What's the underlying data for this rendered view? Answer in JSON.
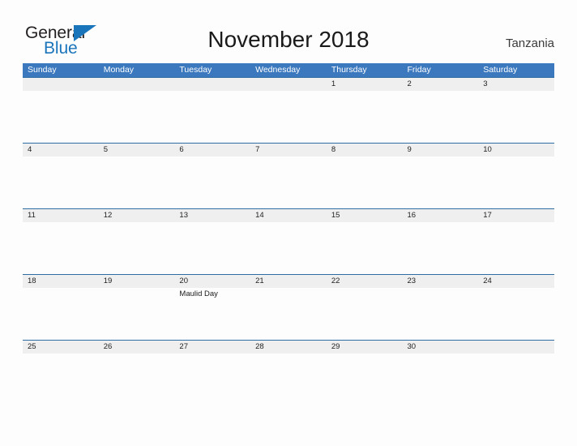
{
  "brand": {
    "name_part1": "General",
    "name_part2": "Blue",
    "triangle_icon": "triangle-icon",
    "color_dark": "#231f20",
    "color_blue": "#1b75bb"
  },
  "header": {
    "title": "November 2018",
    "country": "Tanzania"
  },
  "theme": {
    "header_blue": "#3b78be",
    "rule_blue": "#2e6da4",
    "band_gray": "#efefef",
    "page_background": "#fdfdfd",
    "text_dark": "#222222"
  },
  "calendar": {
    "month": "November",
    "year": "2018",
    "weekday_headers": [
      "Sunday",
      "Monday",
      "Tuesday",
      "Wednesday",
      "Thursday",
      "Friday",
      "Saturday"
    ],
    "weeks": [
      {
        "days": [
          {
            "date": "",
            "events": []
          },
          {
            "date": "",
            "events": []
          },
          {
            "date": "",
            "events": []
          },
          {
            "date": "",
            "events": []
          },
          {
            "date": "1",
            "events": []
          },
          {
            "date": "2",
            "events": []
          },
          {
            "date": "3",
            "events": []
          }
        ]
      },
      {
        "days": [
          {
            "date": "4",
            "events": []
          },
          {
            "date": "5",
            "events": []
          },
          {
            "date": "6",
            "events": []
          },
          {
            "date": "7",
            "events": []
          },
          {
            "date": "8",
            "events": []
          },
          {
            "date": "9",
            "events": []
          },
          {
            "date": "10",
            "events": []
          }
        ]
      },
      {
        "days": [
          {
            "date": "11",
            "events": []
          },
          {
            "date": "12",
            "events": []
          },
          {
            "date": "13",
            "events": []
          },
          {
            "date": "14",
            "events": []
          },
          {
            "date": "15",
            "events": []
          },
          {
            "date": "16",
            "events": []
          },
          {
            "date": "17",
            "events": []
          }
        ]
      },
      {
        "days": [
          {
            "date": "18",
            "events": []
          },
          {
            "date": "19",
            "events": []
          },
          {
            "date": "20",
            "events": [
              "Maulid Day"
            ]
          },
          {
            "date": "21",
            "events": []
          },
          {
            "date": "22",
            "events": []
          },
          {
            "date": "23",
            "events": []
          },
          {
            "date": "24",
            "events": []
          }
        ]
      },
      {
        "days": [
          {
            "date": "25",
            "events": []
          },
          {
            "date": "26",
            "events": []
          },
          {
            "date": "27",
            "events": []
          },
          {
            "date": "28",
            "events": []
          },
          {
            "date": "29",
            "events": []
          },
          {
            "date": "30",
            "events": []
          },
          {
            "date": "",
            "events": []
          }
        ]
      }
    ]
  }
}
